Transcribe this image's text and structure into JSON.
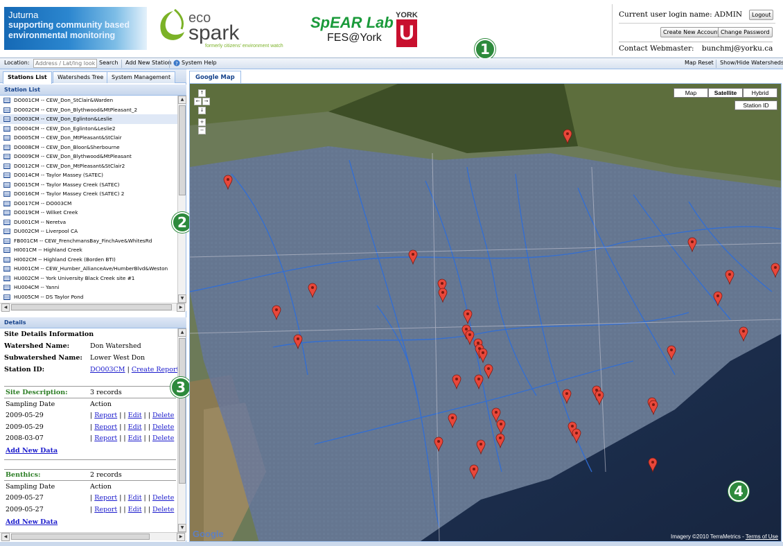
{
  "header": {
    "juturna_title": "Juturna",
    "juturna_tagline": "supporting community based environmental monitoring",
    "eco_word": "eco",
    "spark_word": "spark",
    "eco_sub": "formerly citizens' environment watch",
    "spear_line1": "SpEAR Lab",
    "spear_line2": "FES@York",
    "york_word": "YORK",
    "york_u": "U",
    "badge1": "1",
    "user_label": "Current user login name: ADMIN",
    "logout": "Logout",
    "create_account": "Create New Account",
    "change_password": "Change Password",
    "webmaster_label": "Contact Webmaster:",
    "webmaster_email": "bunchmj@yorku.ca"
  },
  "toolbar": {
    "location_label": "Location:",
    "location_placeholder": "Address / Lat/lng lookup",
    "search": "Search",
    "add_station": "Add New Station",
    "help": "System Help",
    "map_reset": "Map Reset",
    "show_hide": "Show/Hide Watersheds"
  },
  "tabs": [
    "Stations List",
    "Watersheds Tree",
    "System Management"
  ],
  "station_list": {
    "header": "Station List",
    "badge": "2",
    "items": [
      "DO001CM -- CEW_Don_StClair&Warden",
      "DO002CM -- CEW_Don_Blythwood&MtPleasant_2",
      "DO003CM -- CEW_Don_Eglinton&Leslie",
      "DO004CM -- CEW_Don_Eglinton&Leslie2",
      "DO005CM -- CEW_Don_MtPleasant&StClair",
      "DO008CM -- CEW_Don_Bloor&Sherbourne",
      "DO009CM -- CEW_Don_Blythwood&MtPleasant",
      "DO012CM -- CEW_Don_MtPleasant&StClair2",
      "DO014CM -- Taylor Massey (SATEC)",
      "DO015CM -- Taylor Massey Creek (SATEC)",
      "DO016CM -- Taylor Massey Creek (SATEC) 2",
      "DO017CM -- DO003CM",
      "DO019CM -- Wilket Creek",
      "DU001CM -- Neretva",
      "DU002CM -- Liverpool CA",
      "FB001CM -- CEW_FrenchmansBay_FinchAve&WhitesRd",
      "HI001CM -- Highland Creek",
      "HI002CM -- Highland Creek (Borden BTI)",
      "HU001CM -- CEW_Humber_AllianceAve/HumberBlvd&Weston",
      "HU002CM -- York University Black Creek site #1",
      "HU004CM -- Yanni",
      "HU005CM -- DS Taylor Pond"
    ]
  },
  "details": {
    "header": "Details",
    "badge": "3",
    "title": "Site Details Information",
    "watershed_label": "Watershed Name:",
    "watershed_value": "Don Watershed",
    "subwatershed_label": "Subwatershed Name:",
    "subwatershed_value": "Lower West Don",
    "station_label": "Station ID:",
    "station_value": "DO003CM",
    "create_report": "Create Report",
    "site_desc_label": "Site Description:",
    "site_desc_count": "3 records",
    "sampling_date": "Sampling Date",
    "action": "Action",
    "site_rows": [
      "2009-05-29",
      "2009-05-29",
      "2008-03-07"
    ],
    "report": "Report",
    "edit": "Edit",
    "delete": "Delete",
    "add_new_data": "Add New Data",
    "benthics_label": "Benthics:",
    "benthics_count": "2 records",
    "benthic_rows": [
      "2009-05-27",
      "2009-05-27"
    ]
  },
  "map": {
    "tab": "Google Map",
    "types": [
      "Map",
      "Satellite",
      "Hybrid"
    ],
    "active_type": "Satellite",
    "station_id_btn": "Station ID",
    "badge": "4",
    "google": "Google",
    "copyright": "Imagery ©2010 TerraMetrics -",
    "terms": "Terms of Use"
  },
  "colors": {
    "badge_green": "#2d8a3c",
    "marker_red": "#e8473a",
    "link_blue": "#1a1acc",
    "panel_header": "#15428b"
  }
}
